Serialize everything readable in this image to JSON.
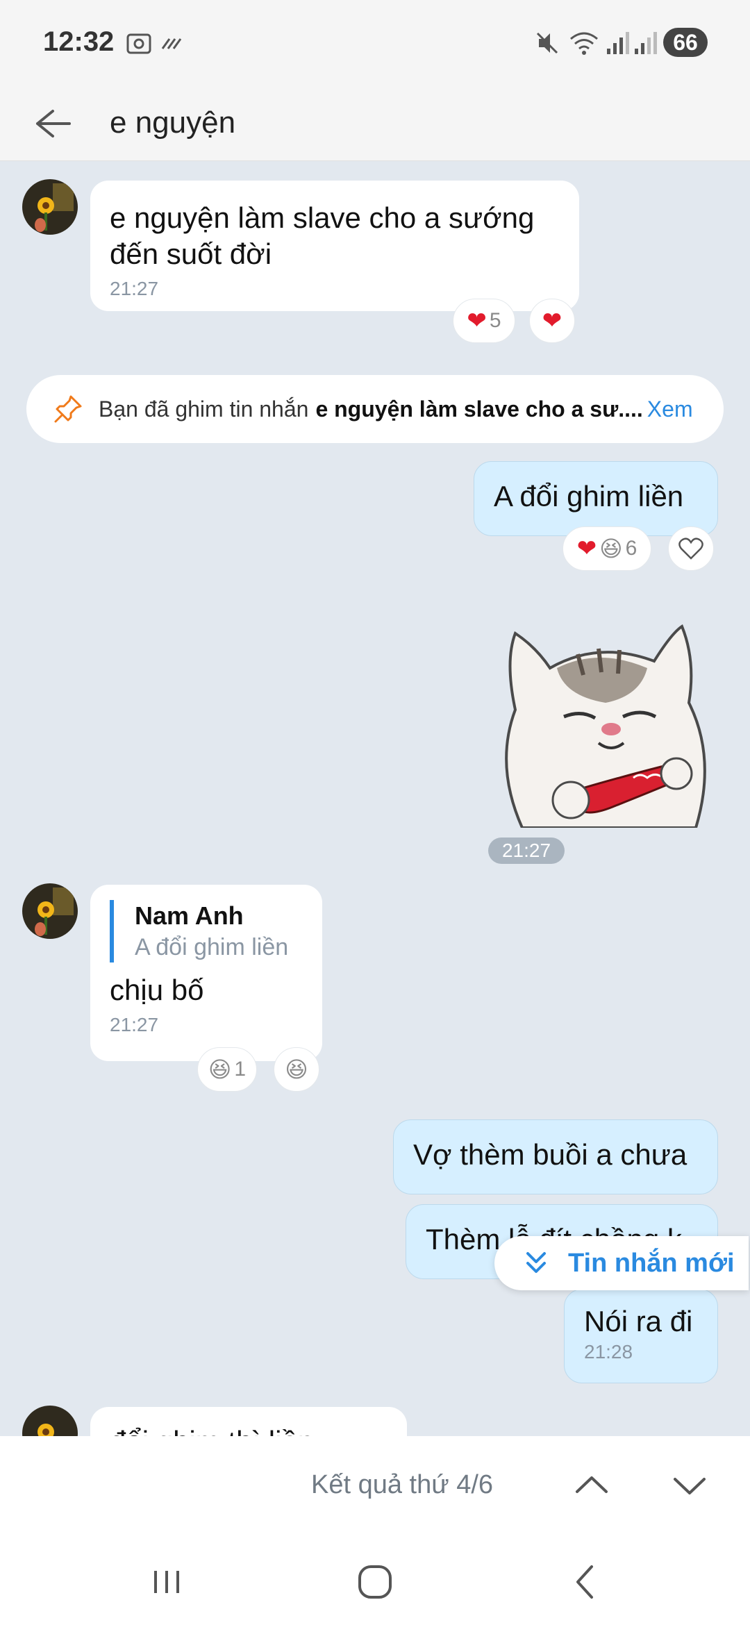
{
  "status_bar": {
    "time": "12:32",
    "battery": "66",
    "icons": [
      "screenshot-icon",
      "data-saver-icon",
      "mute-icon",
      "wifi-icon",
      "signal-icon",
      "signal-icon-2"
    ]
  },
  "header": {
    "title": "e nguyện",
    "back_icon": "back-arrow-icon"
  },
  "messages": [
    {
      "type": "incoming",
      "text": "e nguyện làm slave cho a sướng đến suốt đời",
      "time": "21:27",
      "reactions": {
        "summary": "5",
        "own": "heart"
      }
    },
    {
      "type": "system-pin",
      "prefix": "Bạn đã ghim tin nhắn ",
      "bold": "e nguyện làm slave cho a sư....",
      "link": "Xem"
    },
    {
      "type": "outgoing",
      "text": "A đổi ghim liền",
      "reactions": {
        "summary": "6"
      }
    },
    {
      "type": "outgoing-sticker",
      "sticker": "cat-sticker",
      "time": "21:27"
    },
    {
      "type": "incoming-reply",
      "quote_name": "Nam Anh",
      "quote_text": "A đổi ghim liền",
      "text": "chịu bố",
      "time": "21:27",
      "reactions": {
        "summary": "1"
      }
    },
    {
      "type": "outgoing",
      "text": "Vợ thèm buồi a chưa"
    },
    {
      "type": "outgoing",
      "text": "Thèm lỗ đít chồng k"
    },
    {
      "type": "outgoing",
      "text": "Nói ra đi",
      "time": "21:28"
    },
    {
      "type": "incoming",
      "text": "đổi ghim thì liền"
    }
  ],
  "new_messages_button": {
    "label": "Tin nhắn mới"
  },
  "search": {
    "result_label": "Kết quả thứ 4/6"
  },
  "colors": {
    "accent": "#2a8ae0",
    "chat_bg": "#e2e8ef",
    "outgoing_bubble": "#d6efff",
    "incoming_bubble": "#ffffff",
    "pin_icon": "#f07a1a",
    "heart": "#e21b2c"
  }
}
